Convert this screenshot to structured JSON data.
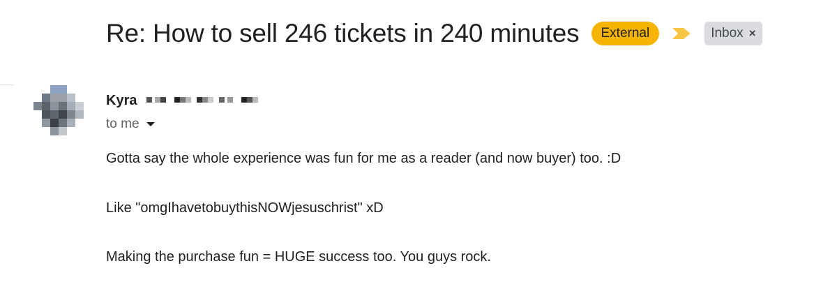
{
  "header": {
    "subject": "Re: How to sell 246 tickets in 240 minutes",
    "external_badge": "External",
    "importance_icon": "important-marker-icon",
    "label": {
      "text": "Inbox",
      "remove_glyph": "×"
    }
  },
  "message": {
    "sender_name": "Kyra",
    "sender_address_redacted": true,
    "recipient_text": "to me",
    "body": [
      "Gotta say the whole experience was fun for me as a reader (and now buyer) too. :D",
      "Like \"omgIhavetobuythisNOWjesuschrist\" xD",
      "Making the purchase fun = HUGE success too. You guys rock."
    ]
  },
  "colors": {
    "external_badge_bg": "#f6b400",
    "importance_marker": "#f6c644",
    "label_chip_bg": "#dadce0",
    "text_primary": "#202124",
    "text_secondary": "#5f6368"
  }
}
